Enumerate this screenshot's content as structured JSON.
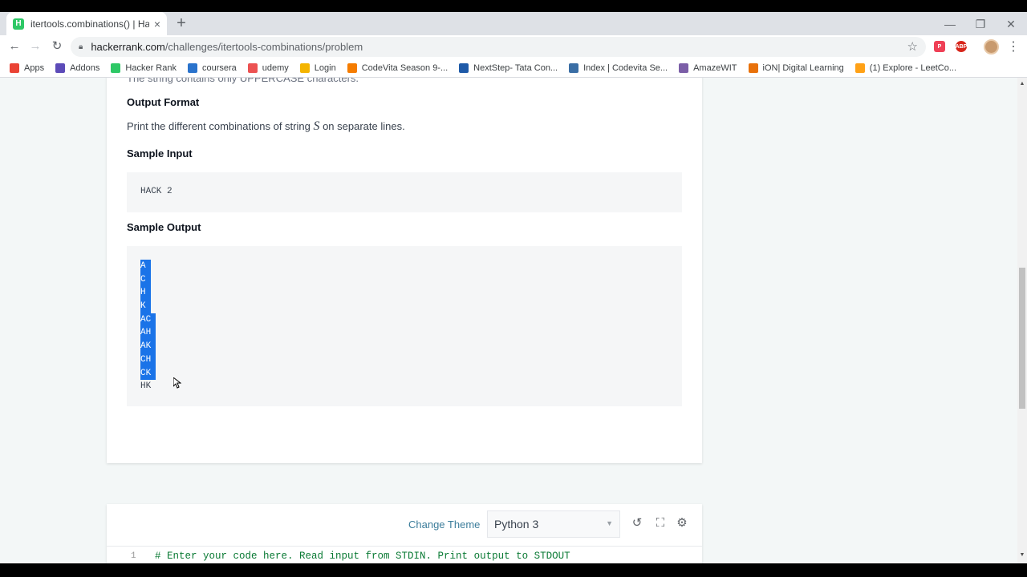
{
  "browser": {
    "tab_title": "itertools.combinations() | Hacker",
    "favicon_letter": "H",
    "tab_close": "×",
    "new_tab": "+",
    "window_controls": {
      "minimize": "—",
      "restore": "❐",
      "close": "✕"
    },
    "url_domain": "hackerrank.com",
    "url_path": "/challenges/itertools-combinations/problem",
    "extensions": [
      {
        "name": "pocket",
        "label": "P",
        "color": "#ef4056"
      },
      {
        "name": "adblock",
        "label": "ABP",
        "color": "#d7261b"
      }
    ],
    "bookmarks": [
      {
        "label": "Apps",
        "icon": "apps-grid-icon",
        "color": "#ea4335"
      },
      {
        "label": "Addons",
        "icon": "addons-icon",
        "color": "#5c4bb8"
      },
      {
        "label": "Hacker Rank",
        "icon": "hackerrank-icon",
        "color": "#2ec866"
      },
      {
        "label": "coursera",
        "icon": "coursera-icon",
        "color": "#2a73cc"
      },
      {
        "label": "udemy",
        "icon": "udemy-icon",
        "color": "#ec5252"
      },
      {
        "label": "Login",
        "icon": "login-icon",
        "color": "#f4b400"
      },
      {
        "label": "CodeVita Season 9-...",
        "icon": "codevita-icon",
        "color": "#f57c00"
      },
      {
        "label": "NextStep- Tata Con...",
        "icon": "tata-icon",
        "color": "#1e5aa8"
      },
      {
        "label": "Index | Codevita Se...",
        "icon": "index-icon",
        "color": "#3a6ea5"
      },
      {
        "label": "AmazeWIT",
        "icon": "amazewit-icon",
        "color": "#7b5ea7"
      },
      {
        "label": "iON| Digital Learning",
        "icon": "ion-icon",
        "color": "#e8710a"
      },
      {
        "label": "(1) Explore - LeetCo...",
        "icon": "leetcode-icon",
        "color": "#ffa116"
      }
    ]
  },
  "problem": {
    "cut_text": "The string contains only UPPERCASE characters.",
    "output_format_heading": "Output Format",
    "output_format_text_before": "Print the different combinations of string ",
    "output_format_math": "S",
    "output_format_text_after": " on separate lines.",
    "sample_input_heading": "Sample Input",
    "sample_input": "HACK 2",
    "sample_output_heading": "Sample Output",
    "sample_output_lines": [
      "A",
      "C",
      "H",
      "K",
      "AC",
      "AH",
      "AK",
      "CH",
      "CK",
      "HK"
    ]
  },
  "editor": {
    "change_theme": "Change Theme",
    "language": "Python 3",
    "line_number": "1",
    "code_line": "# Enter your code here. Read input from STDIN. Print output to STDOUT"
  },
  "colors": {
    "accent_link": "#3c7d9b",
    "selection": "#1a73e8",
    "code_comment": "#0a7a34"
  }
}
